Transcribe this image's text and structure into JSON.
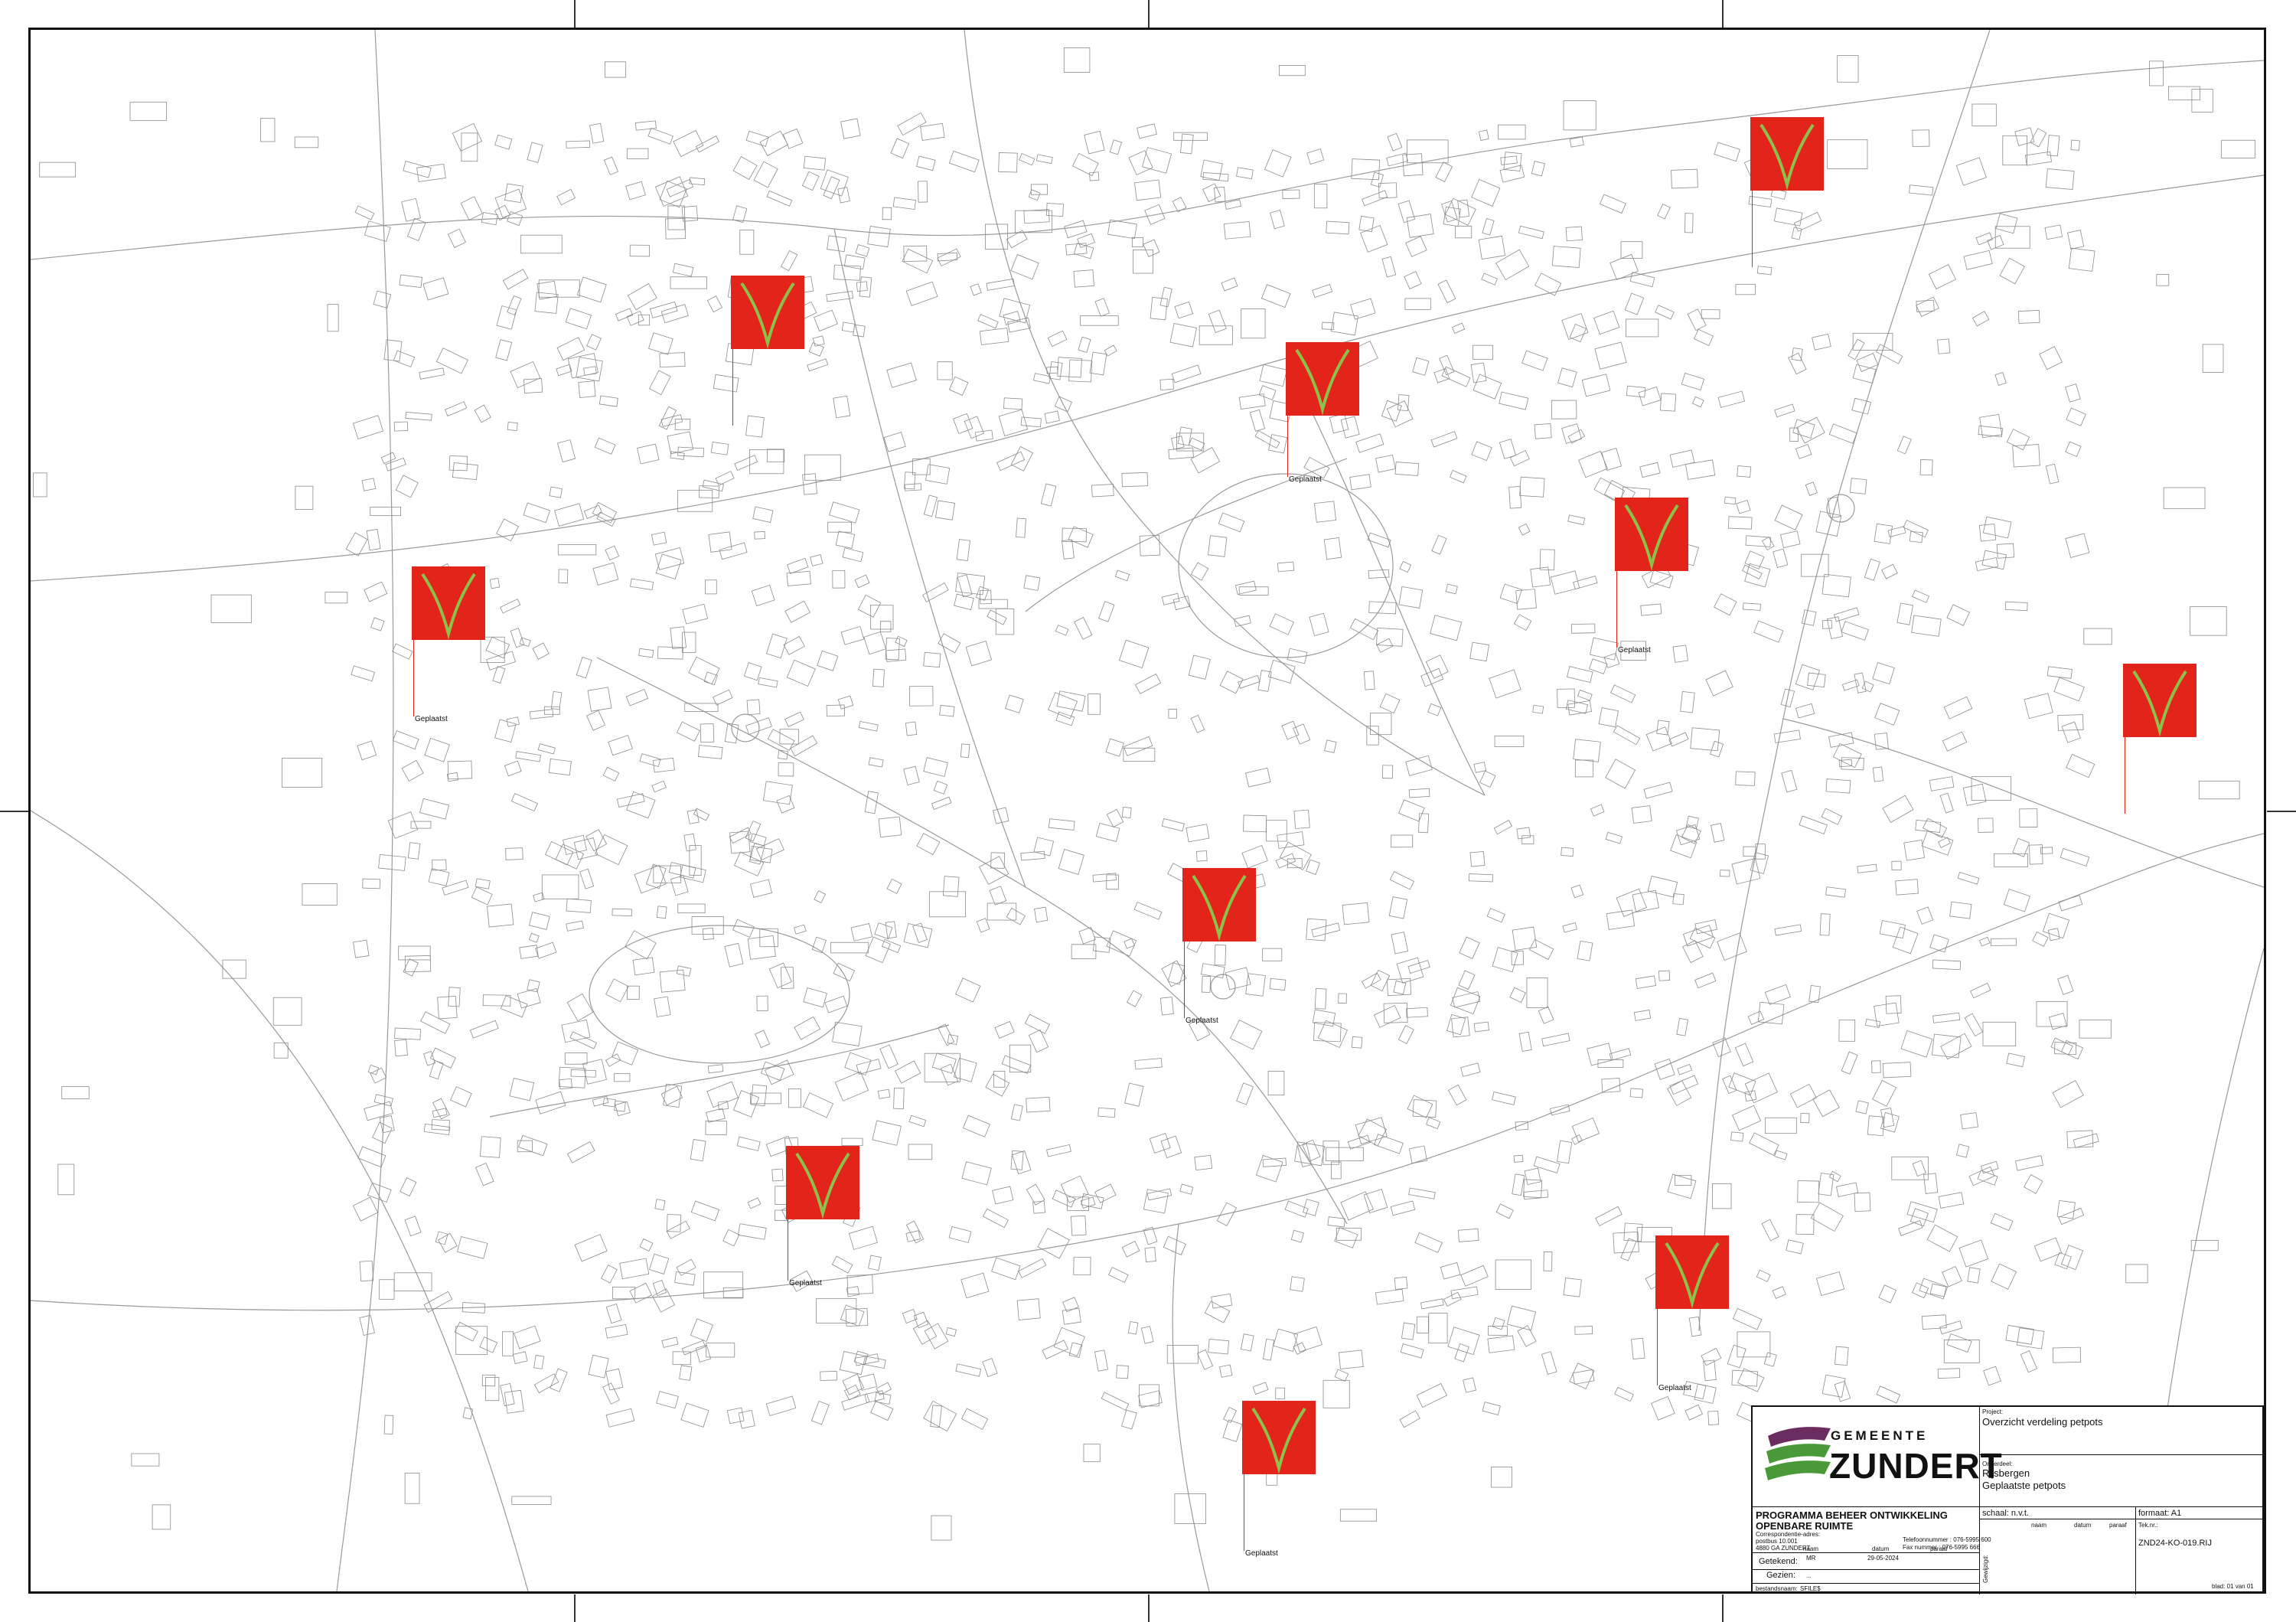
{
  "map": {
    "label_placed": "Geplaatst",
    "label_placed_alt": "Geplaatsl"
  },
  "markers": [
    {
      "id": "m1",
      "label": ""
    },
    {
      "id": "m2",
      "label": ""
    },
    {
      "id": "m3",
      "label": "Geplaatst"
    },
    {
      "id": "m4",
      "label": "Geplaatst"
    },
    {
      "id": "m5",
      "label": "Geplaatst"
    },
    {
      "id": "m6",
      "label": ""
    },
    {
      "id": "m7",
      "label": "Geplaatst"
    },
    {
      "id": "m8",
      "label": "Geplaatst"
    },
    {
      "id": "m9",
      "label": "Geplaatst"
    },
    {
      "id": "m10",
      "label": "Geplaatst"
    },
    {
      "id": "m11",
      "label": ""
    }
  ],
  "colors": {
    "marker": "#e3241b",
    "marker_check": "#8bc34a",
    "logo_green": "#4a9a3a",
    "logo_purple": "#6b2c5f"
  },
  "title_block": {
    "logo_top": "GEMEENTE",
    "logo_main": "ZUNDERT",
    "department_line1": "PROGRAMMA BEHEER ONTWIKKELING",
    "department_line2": "OPENBARE RUIMTE",
    "address_line1": "Correspondentie-adres:",
    "address_line2": "postbus 10.001",
    "address_line3": "4880 GA ZUNDERT",
    "phone_label": "Telefoonnummer : 076-5995 600",
    "fax_label": "Fax nummer : 076-5995 666",
    "project_label": "Project:",
    "project_value": "Overzicht verdeling petpots",
    "part_label": "Onderdeel:",
    "part_value1": "Rijsbergen",
    "part_value2": "Geplaatste petpots",
    "scale_label": "schaal: n.v.t.",
    "format_label": "formaat: A1",
    "col_naam": "naam",
    "col_datum": "datum",
    "col_paraaf": "paraaf",
    "drawn_label": "Getekend:",
    "drawn_name": "MR",
    "drawn_date": "29-05-2024",
    "seen_label": "Gezien:",
    "seen_value": "...",
    "file_label": "bestandsnaam:",
    "file_value": "SFILE$",
    "teknr_label": "Tek.nr.:",
    "teknr_value": "ZND24-KO-019.RIJ",
    "sheet_label": "blad: 01 van 01",
    "revisions_label": "Gewijzigd:"
  }
}
